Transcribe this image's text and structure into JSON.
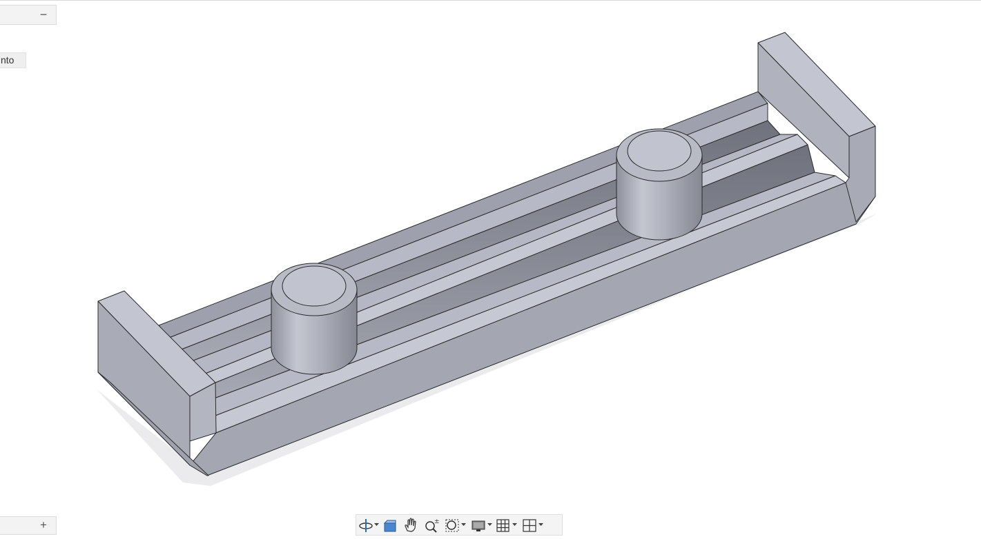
{
  "left_panel": {
    "collapse_symbol": "−",
    "expand_symbol": "+",
    "partial_label": "nto"
  },
  "viewport": {
    "model_color": "#a8aab6",
    "edge_color": "#2a2a2a"
  },
  "navigation_bar": {
    "items": [
      {
        "icon": "orbit-icon",
        "has_dropdown": true
      },
      {
        "icon": "look-at-icon",
        "has_dropdown": false
      },
      {
        "icon": "pan-hand-icon",
        "has_dropdown": false
      },
      {
        "icon": "zoom-icon",
        "has_dropdown": false
      },
      {
        "icon": "fit-window-icon",
        "has_dropdown": true
      },
      {
        "icon": "display-settings-icon",
        "has_dropdown": true
      },
      {
        "icon": "grid-icon",
        "has_dropdown": true
      },
      {
        "icon": "viewports-icon",
        "has_dropdown": true
      }
    ]
  }
}
